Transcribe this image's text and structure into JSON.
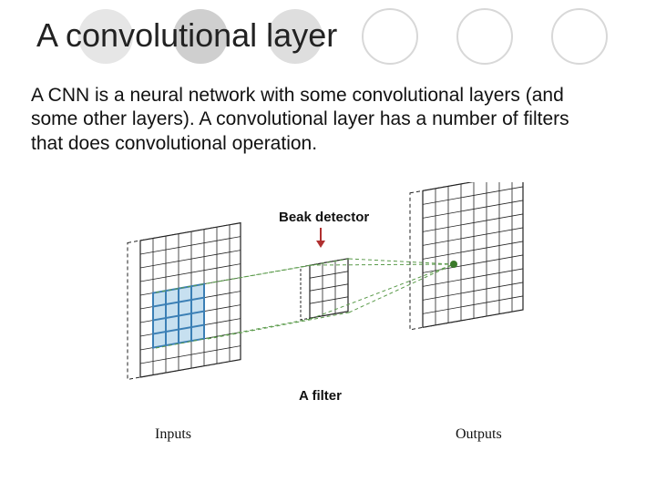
{
  "title": "A convolutional layer",
  "description": "A CNN is a neural network with some convolutional layers (and some other layers).  A convolutional layer has a number of filters that does convolutional operation.",
  "diagram": {
    "annotation_top": "Beak detector",
    "annotation_bottom": "A filter",
    "inputs_label": "Inputs",
    "outputs_label": "Outputs"
  },
  "decor": {
    "circle_colors": [
      "#e6e6e6",
      "#cccccc",
      "#d9d9d9",
      "transparent",
      "transparent",
      "transparent"
    ],
    "circle_stroke": "#d0d0d0",
    "arrow_color": "#b03030",
    "highlight_color": "#5aa0d8",
    "filter_stroke": "#2a2a2a",
    "outline_color": "#222222",
    "dashed_color_green": "#5a9a4a"
  }
}
